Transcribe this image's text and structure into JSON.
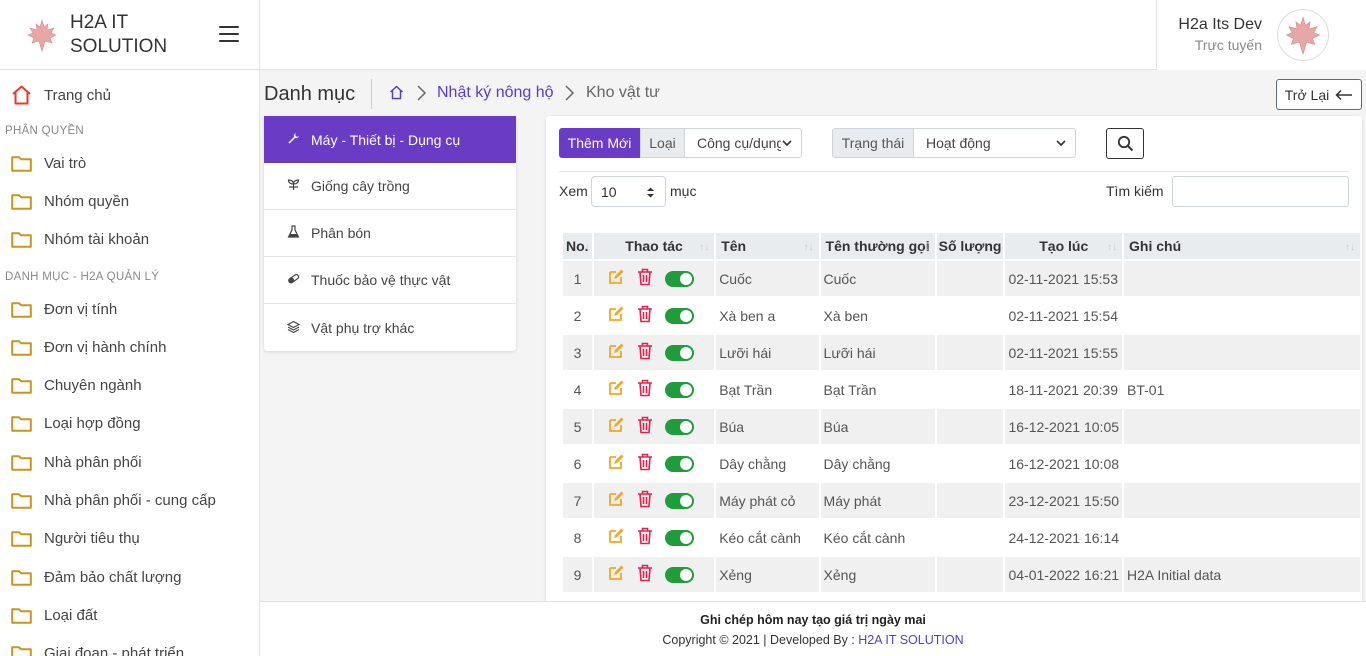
{
  "brand": {
    "line1": "H2A IT",
    "line2": "SOLUTION"
  },
  "user": {
    "name": "H2a Its Dev",
    "status": "Trực tuyến"
  },
  "sidebar": {
    "home": "Trang chủ",
    "section1": "PHÂN QUYỀN",
    "section1_items": [
      "Vai trò",
      "Nhóm quyền",
      "Nhóm tài khoản"
    ],
    "section2": "DANH MỤC - H2A QUẢN LÝ",
    "section2_items": [
      "Đơn vị tính",
      "Đơn vị hành chính",
      "Chuyên ngành",
      "Loại hợp đồng",
      "Nhà phân phối",
      "Nhà phân phối - cung cấp",
      "Người tiêu thụ",
      "Đảm bảo chất lượng",
      "Loại đất",
      "Giai đoạn - phát triển"
    ]
  },
  "breadcrumb": {
    "title": "Danh mục",
    "link": "Nhật ký nông hộ",
    "current": "Kho vật tư",
    "back": "Trở Lại"
  },
  "categories": [
    {
      "label": "Máy - Thiết bị - Dụng cụ",
      "icon": "wrench-icon"
    },
    {
      "label": "Giống cây trồng",
      "icon": "seedling-icon"
    },
    {
      "label": "Phân bón",
      "icon": "flask-icon"
    },
    {
      "label": "Thuốc bảo vệ thực vật",
      "icon": "pill-icon"
    },
    {
      "label": "Vật phụ trợ khác",
      "icon": "layers-icon"
    }
  ],
  "toolbar": {
    "add": "Thêm Mới",
    "type_label": "Loại",
    "type_value": "Công cụ/dụng cụ",
    "status_label": "Trạng thái",
    "status_value": "Hoạt động",
    "show_label": "Xem",
    "page_size": "10",
    "entries_label": "mục",
    "search_label": "Tìm kiếm"
  },
  "table": {
    "headers": [
      "No.",
      "Thao tác",
      "Tên",
      "Tên thường gọi",
      "Số lượng",
      "Tạo lúc",
      "Ghi chú"
    ],
    "rows": [
      {
        "no": "1",
        "name": "Cuốc",
        "common": "Cuốc",
        "qty": "",
        "created": "02-11-2021 15:53",
        "note": ""
      },
      {
        "no": "2",
        "name": "Xà ben a",
        "common": "Xà ben",
        "qty": "",
        "created": "02-11-2021 15:54",
        "note": ""
      },
      {
        "no": "3",
        "name": "Lưỡi hái",
        "common": "Lưỡi hái",
        "qty": "",
        "created": "02-11-2021 15:55",
        "note": ""
      },
      {
        "no": "4",
        "name": "Bạt Trần",
        "common": "Bạt Trần",
        "qty": "",
        "created": "18-11-2021 20:39",
        "note": "BT-01"
      },
      {
        "no": "5",
        "name": "Búa",
        "common": "Búa",
        "qty": "",
        "created": "16-12-2021 10:05",
        "note": ""
      },
      {
        "no": "6",
        "name": "Dây chằng",
        "common": "Dây chằng",
        "qty": "",
        "created": "16-12-2021 10:08",
        "note": ""
      },
      {
        "no": "7",
        "name": "Máy phát cỏ",
        "common": "Máy phát",
        "qty": "",
        "created": "23-12-2021 15:50",
        "note": ""
      },
      {
        "no": "8",
        "name": "Kéo cắt cành",
        "common": "Kéo cắt cành",
        "qty": "",
        "created": "24-12-2021 16:14",
        "note": ""
      },
      {
        "no": "9",
        "name": "Xẻng",
        "common": "Xẻng",
        "qty": "",
        "created": "04-01-2022 16:21",
        "note": "H2A Initial data"
      }
    ]
  },
  "footer": {
    "slogan": "Ghi chép hôm nay tạo giá trị ngày mai",
    "copy": "Copyright © 2021 | Developed By : ",
    "company": "H2A IT SOLUTION"
  },
  "colors": {
    "accent": "#6a3bc4",
    "edit": "#f5a623",
    "delete": "#e0234e",
    "toggle_on": "#1f9d3a",
    "home_icon": "#e53935"
  }
}
